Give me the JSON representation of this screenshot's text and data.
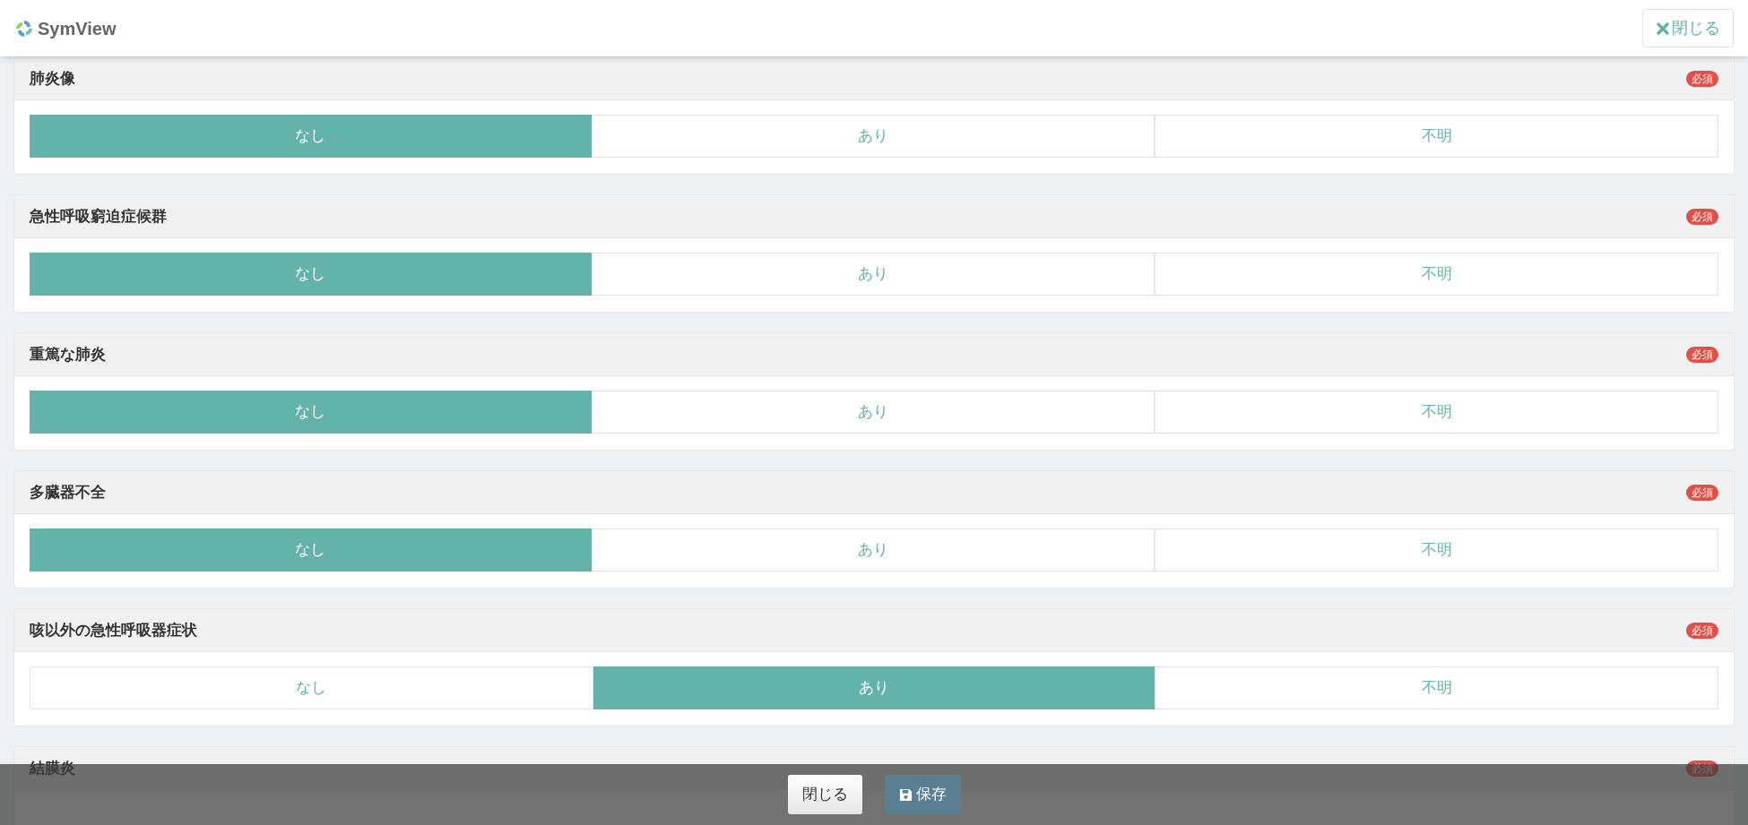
{
  "header": {
    "logo_text": "SymView",
    "close_button": {
      "label": "閉じる"
    }
  },
  "questions": [
    {
      "title": "肺炎像",
      "badge": "必須",
      "options": [
        {
          "label": "なし",
          "selected": true
        },
        {
          "label": "あり",
          "selected": false
        },
        {
          "label": "不明",
          "selected": false
        }
      ]
    },
    {
      "title": "急性呼吸窮迫症候群",
      "badge": "必須",
      "options": [
        {
          "label": "なし",
          "selected": true
        },
        {
          "label": "あり",
          "selected": false
        },
        {
          "label": "不明",
          "selected": false
        }
      ]
    },
    {
      "title": "重篤な肺炎",
      "badge": "必須",
      "options": [
        {
          "label": "なし",
          "selected": true
        },
        {
          "label": "あり",
          "selected": false
        },
        {
          "label": "不明",
          "selected": false
        }
      ]
    },
    {
      "title": "多臓器不全",
      "badge": "必須",
      "options": [
        {
          "label": "なし",
          "selected": true
        },
        {
          "label": "あり",
          "selected": false
        },
        {
          "label": "不明",
          "selected": false
        }
      ]
    },
    {
      "title": "咳以外の急性呼吸器症状",
      "badge": "必須",
      "options": [
        {
          "label": "なし",
          "selected": false
        },
        {
          "label": "あり",
          "selected": true
        },
        {
          "label": "不明",
          "selected": false
        }
      ]
    },
    {
      "title": "結膜炎",
      "badge": "必須"
    }
  ],
  "footer": {
    "buttons": [
      {
        "kind": "close",
        "label": "閉じる"
      },
      {
        "kind": "save",
        "label": "保存"
      }
    ]
  }
}
